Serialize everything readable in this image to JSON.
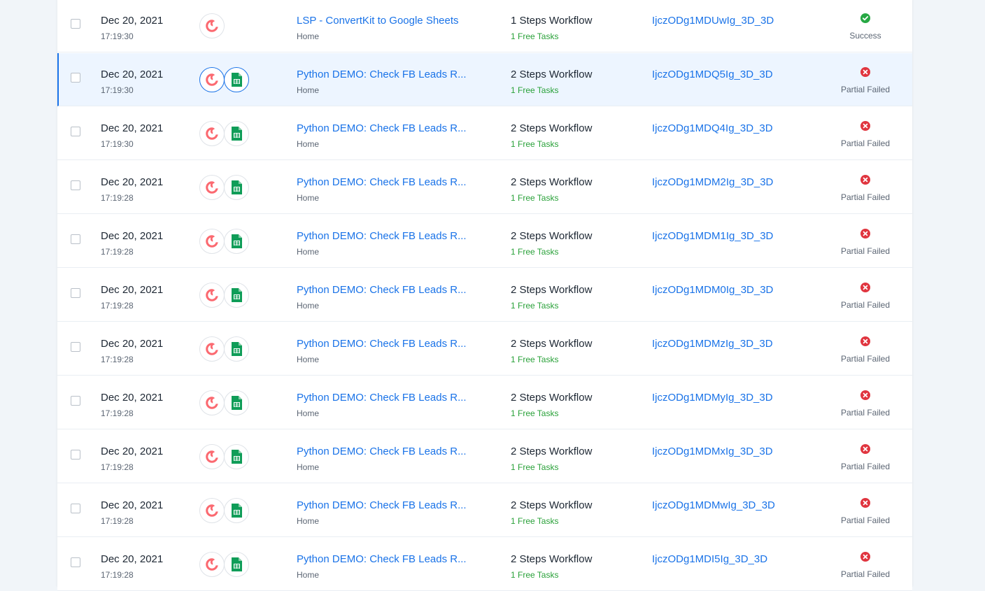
{
  "colors": {
    "accent": "#1a73e8",
    "success": "#27a844",
    "failed": "#e0353f",
    "free_tasks": "#29a139",
    "convertkit": "#fb6970",
    "sheets": "#0f9d58"
  },
  "rows": [
    {
      "date": "Dec 20, 2021",
      "time": "17:19:30",
      "apps": [
        "convertkit-icon"
      ],
      "workflow": "LSP - ConvertKit to Google Sheets",
      "folder": "Home",
      "steps": "1 Steps Workflow",
      "tasks": "1 Free Tasks",
      "run_id": "IjczODg1MDUwIg_3D_3D",
      "status": "Success",
      "status_icon": "check-circle-icon",
      "selected": false
    },
    {
      "date": "Dec 20, 2021",
      "time": "17:19:30",
      "apps": [
        "convertkit-icon",
        "google-sheets-icon"
      ],
      "workflow": "Python DEMO: Check FB Leads R...",
      "folder": "Home",
      "steps": "2 Steps Workflow",
      "tasks": "1 Free Tasks",
      "run_id": "IjczODg1MDQ5Ig_3D_3D",
      "status": "Partial Failed",
      "status_icon": "x-circle-icon",
      "selected": true
    },
    {
      "date": "Dec 20, 2021",
      "time": "17:19:30",
      "apps": [
        "convertkit-icon",
        "google-sheets-icon"
      ],
      "workflow": "Python DEMO: Check FB Leads R...",
      "folder": "Home",
      "steps": "2 Steps Workflow",
      "tasks": "1 Free Tasks",
      "run_id": "IjczODg1MDQ4Ig_3D_3D",
      "status": "Partial Failed",
      "status_icon": "x-circle-icon",
      "selected": false
    },
    {
      "date": "Dec 20, 2021",
      "time": "17:19:28",
      "apps": [
        "convertkit-icon",
        "google-sheets-icon"
      ],
      "workflow": "Python DEMO: Check FB Leads R...",
      "folder": "Home",
      "steps": "2 Steps Workflow",
      "tasks": "1 Free Tasks",
      "run_id": "IjczODg1MDM2Ig_3D_3D",
      "status": "Partial Failed",
      "status_icon": "x-circle-icon",
      "selected": false
    },
    {
      "date": "Dec 20, 2021",
      "time": "17:19:28",
      "apps": [
        "convertkit-icon",
        "google-sheets-icon"
      ],
      "workflow": "Python DEMO: Check FB Leads R...",
      "folder": "Home",
      "steps": "2 Steps Workflow",
      "tasks": "1 Free Tasks",
      "run_id": "IjczODg1MDM1Ig_3D_3D",
      "status": "Partial Failed",
      "status_icon": "x-circle-icon",
      "selected": false
    },
    {
      "date": "Dec 20, 2021",
      "time": "17:19:28",
      "apps": [
        "convertkit-icon",
        "google-sheets-icon"
      ],
      "workflow": "Python DEMO: Check FB Leads R...",
      "folder": "Home",
      "steps": "2 Steps Workflow",
      "tasks": "1 Free Tasks",
      "run_id": "IjczODg1MDM0Ig_3D_3D",
      "status": "Partial Failed",
      "status_icon": "x-circle-icon",
      "selected": false
    },
    {
      "date": "Dec 20, 2021",
      "time": "17:19:28",
      "apps": [
        "convertkit-icon",
        "google-sheets-icon"
      ],
      "workflow": "Python DEMO: Check FB Leads R...",
      "folder": "Home",
      "steps": "2 Steps Workflow",
      "tasks": "1 Free Tasks",
      "run_id": "IjczODg1MDMzIg_3D_3D",
      "status": "Partial Failed",
      "status_icon": "x-circle-icon",
      "selected": false
    },
    {
      "date": "Dec 20, 2021",
      "time": "17:19:28",
      "apps": [
        "convertkit-icon",
        "google-sheets-icon"
      ],
      "workflow": "Python DEMO: Check FB Leads R...",
      "folder": "Home",
      "steps": "2 Steps Workflow",
      "tasks": "1 Free Tasks",
      "run_id": "IjczODg1MDMyIg_3D_3D",
      "status": "Partial Failed",
      "status_icon": "x-circle-icon",
      "selected": false
    },
    {
      "date": "Dec 20, 2021",
      "time": "17:19:28",
      "apps": [
        "convertkit-icon",
        "google-sheets-icon"
      ],
      "workflow": "Python DEMO: Check FB Leads R...",
      "folder": "Home",
      "steps": "2 Steps Workflow",
      "tasks": "1 Free Tasks",
      "run_id": "IjczODg1MDMxIg_3D_3D",
      "status": "Partial Failed",
      "status_icon": "x-circle-icon",
      "selected": false
    },
    {
      "date": "Dec 20, 2021",
      "time": "17:19:28",
      "apps": [
        "convertkit-icon",
        "google-sheets-icon"
      ],
      "workflow": "Python DEMO: Check FB Leads R...",
      "folder": "Home",
      "steps": "2 Steps Workflow",
      "tasks": "1 Free Tasks",
      "run_id": "IjczODg1MDMwIg_3D_3D",
      "status": "Partial Failed",
      "status_icon": "x-circle-icon",
      "selected": false
    },
    {
      "date": "Dec 20, 2021",
      "time": "17:19:28",
      "apps": [
        "convertkit-icon",
        "google-sheets-icon"
      ],
      "workflow": "Python DEMO: Check FB Leads R...",
      "folder": "Home",
      "steps": "2 Steps Workflow",
      "tasks": "1 Free Tasks",
      "run_id": "IjczODg1MDI5Ig_3D_3D",
      "status": "Partial Failed",
      "status_icon": "x-circle-icon",
      "selected": false
    }
  ]
}
